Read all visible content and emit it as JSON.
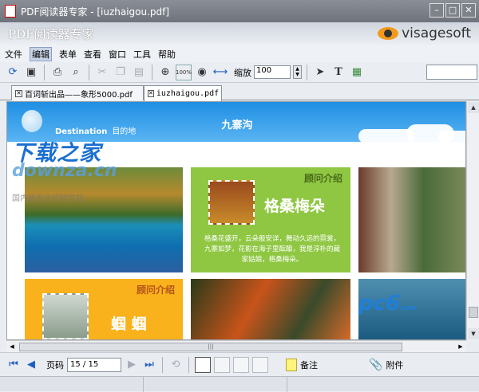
{
  "window": {
    "title": "PDF阅读器专家 - [iuzhaigou.pdf]"
  },
  "banner": {
    "app_name": "PDF阅读器专家",
    "brand": "visagesoft"
  },
  "menu": [
    "文件",
    "编辑",
    "表单",
    "查看",
    "窗口",
    "工具",
    "帮助"
  ],
  "toolbar": {
    "zoom_label": "缩放",
    "zoom_value": "100"
  },
  "tabs": [
    {
      "label": "百词斩出品——象形5000.pdf",
      "active": false
    },
    {
      "label": "iuzhaigou.pdf",
      "active": true
    }
  ],
  "document": {
    "header_title": "九寨沟",
    "destination_label": "Destination",
    "destination_cn": "目的地",
    "card1_heading": "顾问介绍",
    "card1_name": "格桑梅朵",
    "card1_desc": "格桑花盛开，云朵般安详，舞动久远的霓裳，九寨如梦，花影在海子里酝酿，我是淳朴的藏家姑娘，格桑梅朵。",
    "card2_heading": "顾问介绍",
    "card2_name": "蝈 蝈"
  },
  "watermarks": {
    "downza_cn": "下载之家",
    "downza_en": "downza.cn",
    "downza_sub": "国内最安全的软件站",
    "pc6": "pc6",
    "pc6_suffix": "com"
  },
  "navigation": {
    "page_label": "页码",
    "page_value": "15 / 15",
    "note_label": "备注",
    "attach_label": "附件"
  }
}
